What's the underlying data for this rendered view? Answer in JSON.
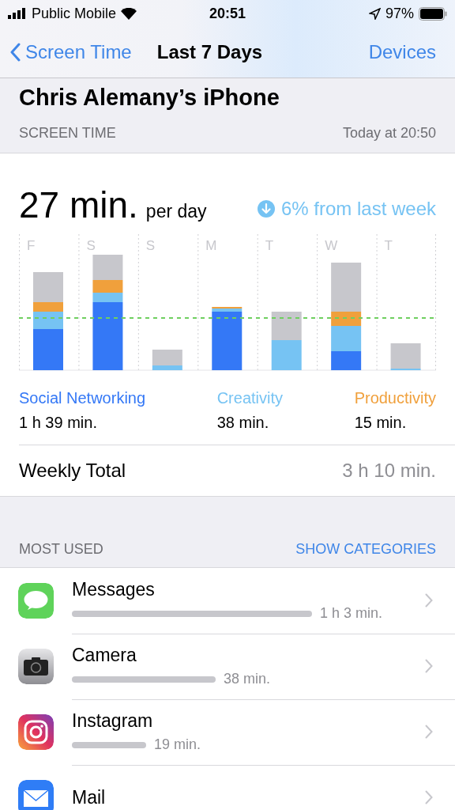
{
  "status_bar": {
    "carrier": "Public Mobile",
    "time": "20:51",
    "battery": "97%"
  },
  "nav": {
    "back": "Screen Time",
    "title": "Last 7 Days",
    "action": "Devices"
  },
  "device_name": "Chris Alemany’s iPhone",
  "section": {
    "label": "SCREEN TIME",
    "updated": "Today at 20:50"
  },
  "summary": {
    "value": "27 min.",
    "unit": "per day",
    "change": "6% from last week"
  },
  "chart": {
    "days": [
      "F",
      "S",
      "S",
      "M",
      "T",
      "W",
      "T"
    ]
  },
  "categories": [
    {
      "name": "Social Networking",
      "time": "1 h 39 min.",
      "color": "#3478f6"
    },
    {
      "name": "Creativity",
      "time": "38 min.",
      "color": "#76c3f3"
    },
    {
      "name": "Productivity",
      "time": "15 min.",
      "color": "#f0a03c"
    }
  ],
  "weekly_total": {
    "label": "Weekly Total",
    "value": "3 h 10 min."
  },
  "most_used": {
    "label": "MOST USED",
    "action": "SHOW CATEGORIES"
  },
  "apps": [
    {
      "kind": "messages",
      "name": "Messages",
      "time": "1 h 3 min."
    },
    {
      "kind": "camera",
      "name": "Camera",
      "time": "38 min."
    },
    {
      "kind": "instagram",
      "name": "Instagram",
      "time": "19 min."
    },
    {
      "kind": "mail",
      "name": "Mail"
    }
  ]
}
